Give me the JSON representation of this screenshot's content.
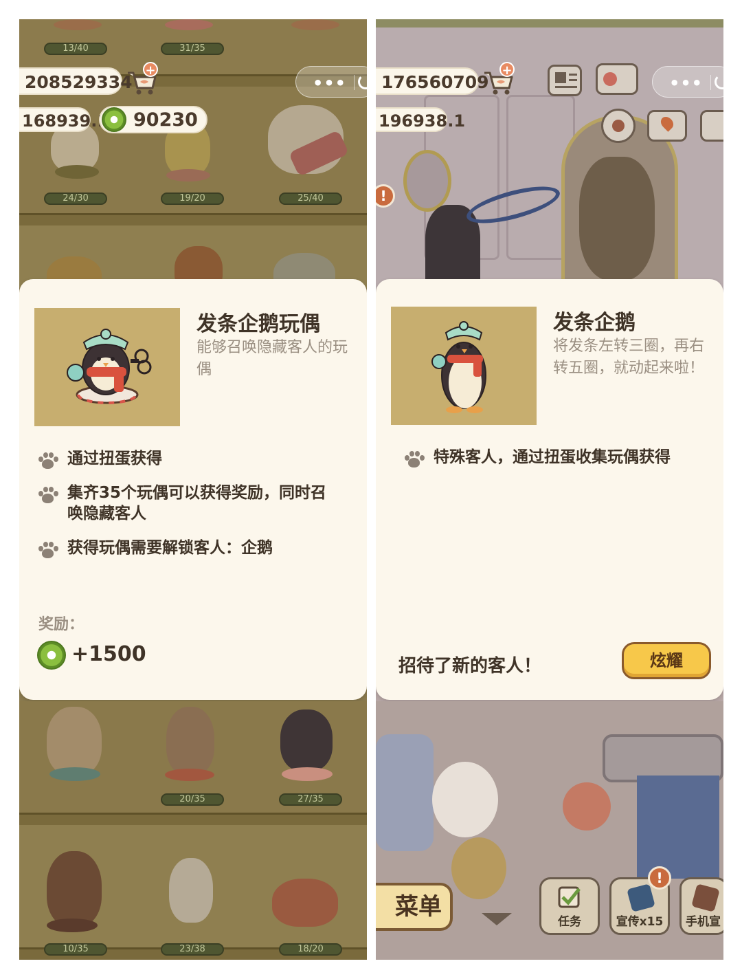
{
  "left_screen": {
    "shelf_counts": {
      "row0": [
        "13/40",
        "31/35"
      ],
      "row1": [
        "24/30",
        "19/20",
        "25/40"
      ],
      "row2": [
        "20/35",
        "27/35"
      ],
      "row3": [
        "10/35",
        "23/38",
        "18/20"
      ]
    },
    "hud": {
      "fish_count": "208529334",
      "money": "168939.1",
      "coins": "90230",
      "plus_symbol": "+"
    },
    "card": {
      "title": "发条企鹅玩偶",
      "description": "能够召唤隐藏客人的玩偶",
      "bullets": [
        "通过扭蛋获得",
        "集齐35个玩偶可以获得奖励，同时召唤隐藏客人",
        "获得玩偶需要解锁客人：企鹅"
      ],
      "reward_label": "奖励：",
      "reward_value": "+1500"
    }
  },
  "right_screen": {
    "hud": {
      "fish_count": "176560709",
      "money": "196938.1",
      "plus_symbol": "+"
    },
    "card": {
      "title": "发条企鹅",
      "description": "将发条左转三圈，再右转五圈，就动起来啦！",
      "bullets": [
        "特殊客人，通过扭蛋收集玩偶获得"
      ],
      "bottom_text": "招待了新的客人！",
      "show_button": "炫耀"
    },
    "bottom_bar": {
      "menu_label": "菜单",
      "task_label": "任务",
      "promote_label": "宣传x15",
      "phone_label": "手机宣",
      "alert_symbol": "!"
    }
  },
  "colors": {
    "card_bg": "#fcf7ec",
    "thumb_bg": "#c7ae6f",
    "button_yellow": "#f7c84a",
    "text_dark": "#3f3327",
    "text_muted": "#9a8f82"
  }
}
